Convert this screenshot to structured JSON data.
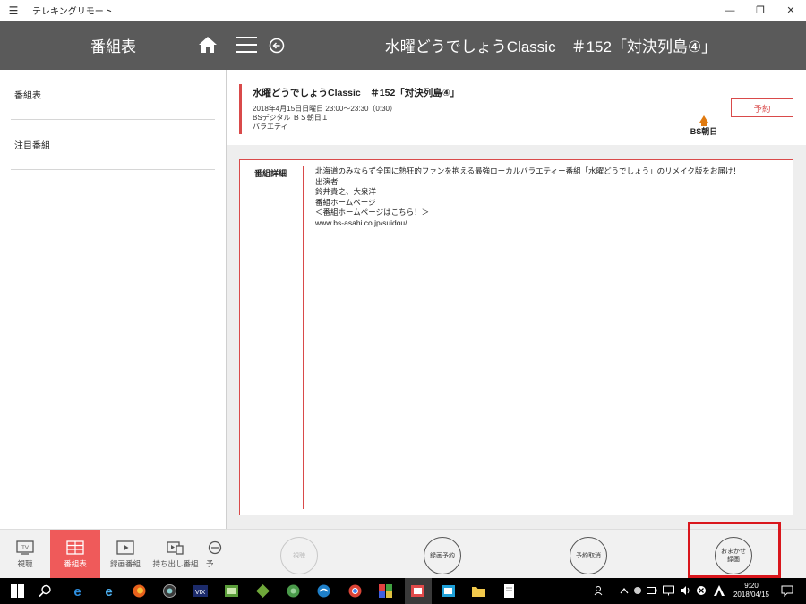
{
  "window": {
    "title": "テレキングリモート",
    "controls": {
      "minimize": "—",
      "maximize": "❐",
      "close": "✕"
    }
  },
  "header": {
    "left_title": "番組表",
    "main_title": "水曜どうでしょうClassic　＃152「対決列島④」"
  },
  "sidebar": {
    "items": [
      {
        "label": "番組表"
      },
      {
        "label": "注目番組"
      }
    ]
  },
  "bottom_tabs": [
    {
      "label": "視聴",
      "icon": "tv-icon",
      "active": false
    },
    {
      "label": "番組表",
      "icon": "grid-icon",
      "active": true
    },
    {
      "label": "録画番組",
      "icon": "play-icon",
      "active": false
    },
    {
      "label": "持ち出し番組",
      "icon": "takeout-icon",
      "active": false
    },
    {
      "label": "予",
      "icon": "reservation-icon",
      "active": false
    }
  ],
  "program": {
    "title": "水曜どうでしょうClassic　＃152「対決列島④」",
    "datetime": "2018年4月15日日曜日 23:00～23:30（0:30）",
    "channel": "BSデジタル ＢＳ朝日１",
    "genre": "バラエティ",
    "reserve_label": "予約",
    "channel_logo_text": "BS朝日"
  },
  "detail": {
    "label": "番組詳細",
    "lines": [
      "北海道のみならず全国に熱狂的ファンを抱える最強ローカルバラエティー番組「水曜どうでしょう」のリメイク版をお届け！",
      "出演者",
      "鈴井貴之、大泉洋",
      "番組ホームページ",
      "＜番組ホームページはこちら！＞",
      "www.bs-asahi.co.jp/suidou/"
    ]
  },
  "actions": {
    "watch": "視聴",
    "record_reserve": "録画予約",
    "cancel_reserve": "予約取消",
    "auto_record_line1": "おまかせ",
    "auto_record_line2": "録画"
  },
  "taskbar": {
    "time": "9:20",
    "date": "2018/04/15"
  },
  "colors": {
    "accent": "#d94a4a",
    "header_bg": "#5a5a5a",
    "active_tab": "#ef5a5a",
    "highlight": "#d9161c"
  }
}
